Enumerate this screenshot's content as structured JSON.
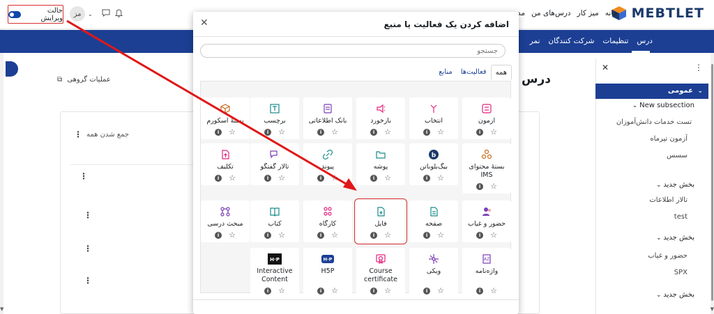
{
  "topbar": {
    "brand": "MEBTLET",
    "nav": [
      "خانه",
      "میز کار",
      "درس‌های من",
      "مدیری"
    ],
    "edit_mode_label": "حالت ویرایش",
    "user_initials": "مز"
  },
  "bluebar": {
    "tabs": [
      "درس",
      "تنظیمات",
      "شرکت کنندگان",
      "نمر"
    ]
  },
  "drawer": {
    "general": "عمومی",
    "items": [
      {
        "label": "New subsection",
        "bold": true
      },
      {
        "label": "تست خدمات دانش‌آموزان",
        "bold": false
      },
      {
        "label": "آزمون تیرماه",
        "bold": false
      },
      {
        "label": "سسس",
        "bold": false
      },
      {
        "label": "بخش جدید",
        "bold": true
      },
      {
        "label": "تالار اطلاعات",
        "bold": false
      },
      {
        "label": "test",
        "bold": false
      },
      {
        "label": "بخش جدید",
        "bold": true
      },
      {
        "label": "حضور و غیاب",
        "bold": false
      },
      {
        "label": "SPX",
        "bold": false
      },
      {
        "label": "بخش جدید",
        "bold": true
      }
    ]
  },
  "content": {
    "course_title": "درس",
    "group_ops": "عملیات گروهی",
    "collapse_all": "جمع شدن همه"
  },
  "modal": {
    "title": "اضافه کردن یک فعالیت یا منبع",
    "search_placeholder": "جستجو",
    "tabs": [
      "همه",
      "فعالیت‌ها",
      "منابع"
    ],
    "footer_text": "... ... ... ...",
    "tiles": [
      {
        "label": "آزمون",
        "icon": "quiz-icon",
        "color": "#e2237d"
      },
      {
        "label": "انتخاب",
        "icon": "choice-icon",
        "color": "#e2237d"
      },
      {
        "label": "بازخورد",
        "icon": "feedback-icon",
        "color": "#e2237d"
      },
      {
        "label": "بانک اطلاعاتی",
        "icon": "database-icon",
        "color": "#7b3fb8"
      },
      {
        "label": "برچسب",
        "icon": "label-icon",
        "color": "#1a8a8a"
      },
      {
        "label": "بستهٔ اسکورم",
        "icon": "scorm-icon",
        "color": "#c76a1a"
      },
      {
        "label": "بستهٔ محتوای IMS",
        "icon": "ims-icon",
        "color": "#c76a1a"
      },
      {
        "label": "بیگ‌بلوباتن",
        "icon": "bigbluebutton-icon",
        "color": "#1b3a6b"
      },
      {
        "label": "پوشه",
        "icon": "folder-icon",
        "color": "#1a8a8a"
      },
      {
        "label": "پیوند",
        "icon": "url-icon",
        "color": "#1a8a8a"
      },
      {
        "label": "تالار گفتگو",
        "icon": "forum-icon",
        "color": "#7b3fb8"
      },
      {
        "label": "تکلیف",
        "icon": "assignment-icon",
        "color": "#e2237d"
      },
      {
        "label": "حضور و غیاب",
        "icon": "attendance-icon",
        "color": "#7b3fb8"
      },
      {
        "label": "صفحه",
        "icon": "page-icon",
        "color": "#1a8a8a"
      },
      {
        "label": "فایل",
        "icon": "file-icon",
        "color": "#1a8a8a"
      },
      {
        "label": "کارگاه",
        "icon": "workshop-icon",
        "color": "#e2237d"
      },
      {
        "label": "کتاب",
        "icon": "book-icon",
        "color": "#1a8a8a"
      },
      {
        "label": "مبحث درسی",
        "icon": "lesson-icon",
        "color": "#7b3fb8"
      },
      {
        "label": "واژه‌نامه",
        "icon": "glossary-icon",
        "color": "#7b3fb8"
      },
      {
        "label": "ویکی",
        "icon": "wiki-icon",
        "color": "#7b3fb8"
      },
      {
        "label": "Course certificate",
        "icon": "certificate-icon",
        "color": "#e2237d"
      },
      {
        "label": "H5P",
        "icon": "h5p-icon",
        "color": "#1b3a6b"
      },
      {
        "label": "Interactive Content",
        "icon": "interactive-content-icon",
        "color": "#111111"
      }
    ]
  },
  "colors": {
    "brand_blue": "#1c3f94",
    "highlight_red": "#d93030"
  }
}
